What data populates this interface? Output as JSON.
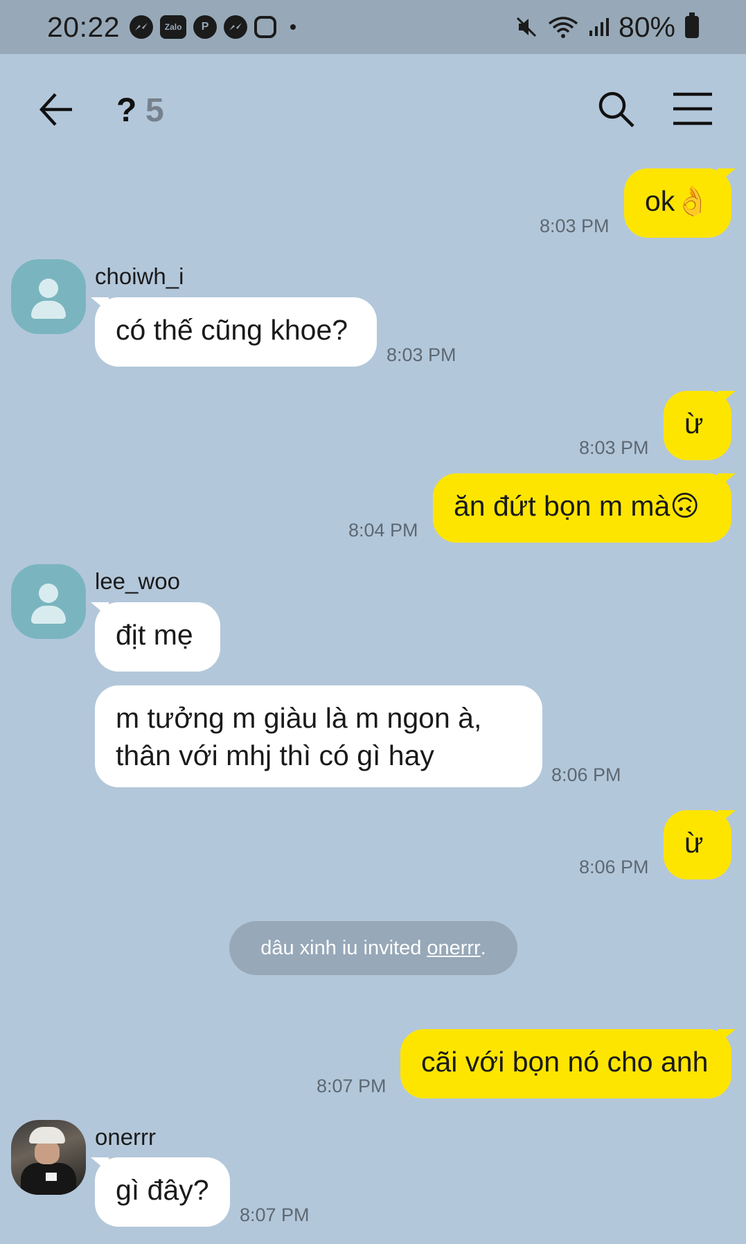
{
  "status_bar": {
    "time": "20:22",
    "app_icons": [
      "messenger-icon",
      "zalo-icon",
      "pinterest-icon",
      "messenger-icon",
      "instagram-icon"
    ],
    "zalo_text": "Zalo",
    "battery": "80%"
  },
  "header": {
    "title": "?",
    "member_count": "5"
  },
  "messages": [
    {
      "from": "me",
      "text": "ok👌",
      "time": "8:03 PM"
    },
    {
      "from": "choiwh_i",
      "text": "có thế cũng khoe?",
      "time": "8:03 PM"
    },
    {
      "from": "me",
      "text": "ừ",
      "time": "8:03 PM"
    },
    {
      "from": "me",
      "text": "ăn đứt bọn m mà🙃",
      "time": "8:04 PM"
    },
    {
      "from": "lee_woo",
      "text": "địt mẹ",
      "time": ""
    },
    {
      "from": "lee_woo",
      "text_line1": "m tưởng m giàu là m ngon à,",
      "text_line2": "thân với mhj thì có gì hay",
      "time": "8:06 PM"
    },
    {
      "from": "me",
      "text": "ừ",
      "time": "8:06 PM"
    },
    {
      "from": "me",
      "text": "cãi với bọn nó cho anh",
      "time": "8:07 PM"
    },
    {
      "from": "onerrr",
      "text": "gì đây?",
      "time": "8:07 PM"
    }
  ],
  "senders": {
    "choiwh_i": "choiwh_i",
    "lee_woo": "lee_woo",
    "onerrr": "onerrr"
  },
  "system": {
    "text": "dâu xinh iu invited",
    "link": "onerrr ",
    "suffix": "."
  },
  "colors": {
    "background": "#b3c7da",
    "my_bubble": "#fee500",
    "their_bubble": "#ffffff",
    "default_avatar": "#7ab5bf"
  }
}
